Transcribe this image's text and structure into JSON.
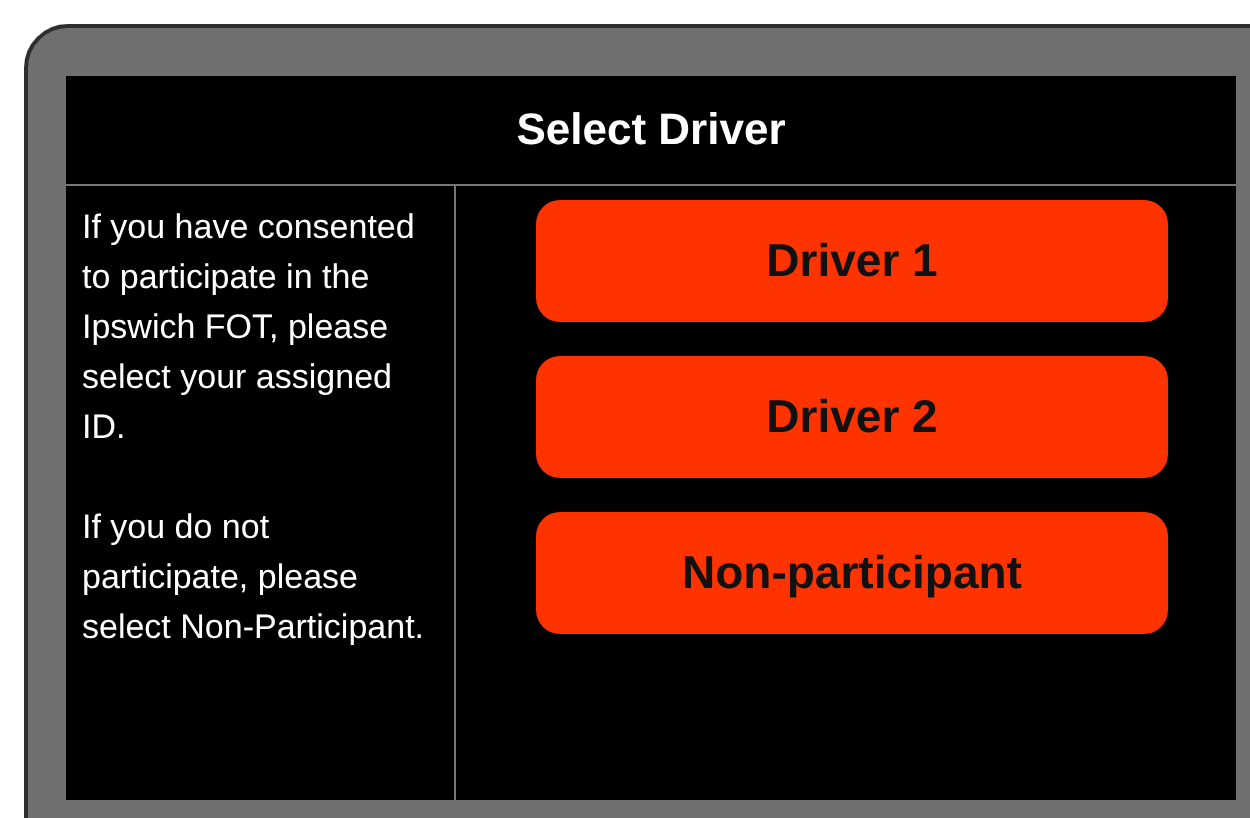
{
  "title": "Select Driver",
  "instructions": [
    "If you have consented to participate in the Ipswich FOT, please select your assigned ID.",
    "If you do not participate, please select Non-Participant."
  ],
  "buttons": [
    {
      "label": "Driver 1"
    },
    {
      "label": "Driver 2"
    },
    {
      "label": "Non-participant"
    }
  ]
}
